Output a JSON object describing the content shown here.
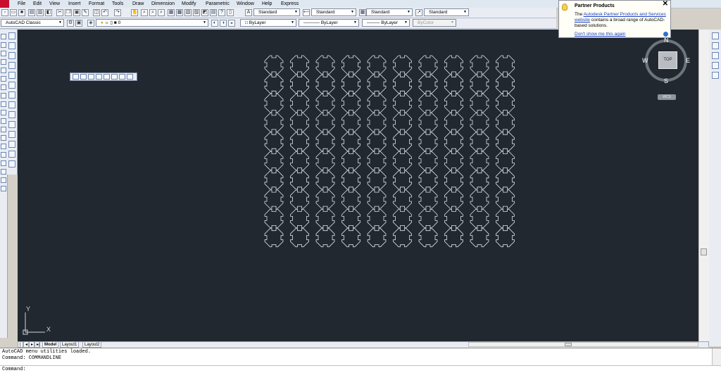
{
  "menu": [
    "File",
    "Edit",
    "View",
    "Insert",
    "Format",
    "Tools",
    "Draw",
    "Dimension",
    "Modify",
    "Parametric",
    "Window",
    "Help",
    "Express"
  ],
  "styles": {
    "text_style": "Standard",
    "dim_style": "Standard",
    "table_style": "Standard",
    "mleader_style": "Standard"
  },
  "workspace": "AutoCAD Classic",
  "layer": "0",
  "properties": {
    "color": "ByLayer",
    "linetype": "ByLayer",
    "lineweight": "ByLayer",
    "plotstyle": "ByColor"
  },
  "tabs": [
    "Model",
    "Layout1",
    "Layout2"
  ],
  "active_tab": "Model",
  "command_history": [
    "AutoCAD menu utilities loaded.",
    "Command: COMMANDLINE"
  ],
  "command_prompt": "Command:",
  "balloon": {
    "title": "Partner Products",
    "text_pre": "The ",
    "link": "Autodesk Partner Products and Services website",
    "text_post": " contains a broad range of AutoCAD-based solutions.",
    "dont_show": "Don't show me this again"
  },
  "viewcube": {
    "top": "TOP",
    "n": "N",
    "s": "S",
    "e": "E",
    "w": "W",
    "wcs": "WCS"
  },
  "ucs": {
    "x": "X",
    "y": "Y"
  },
  "drawing": {
    "rows": 10,
    "cols": 10,
    "stroke": "#dfe3e8",
    "background": "#212830"
  },
  "icons": {
    "new": "new-icon",
    "open": "open-folder-icon",
    "save": "save-icon",
    "print": "print-icon",
    "undo": "undo-icon",
    "redo": "redo-icon",
    "pan": "hand-icon",
    "zoom": "zoom-icon",
    "line": "line-icon",
    "circle": "circle-icon"
  }
}
